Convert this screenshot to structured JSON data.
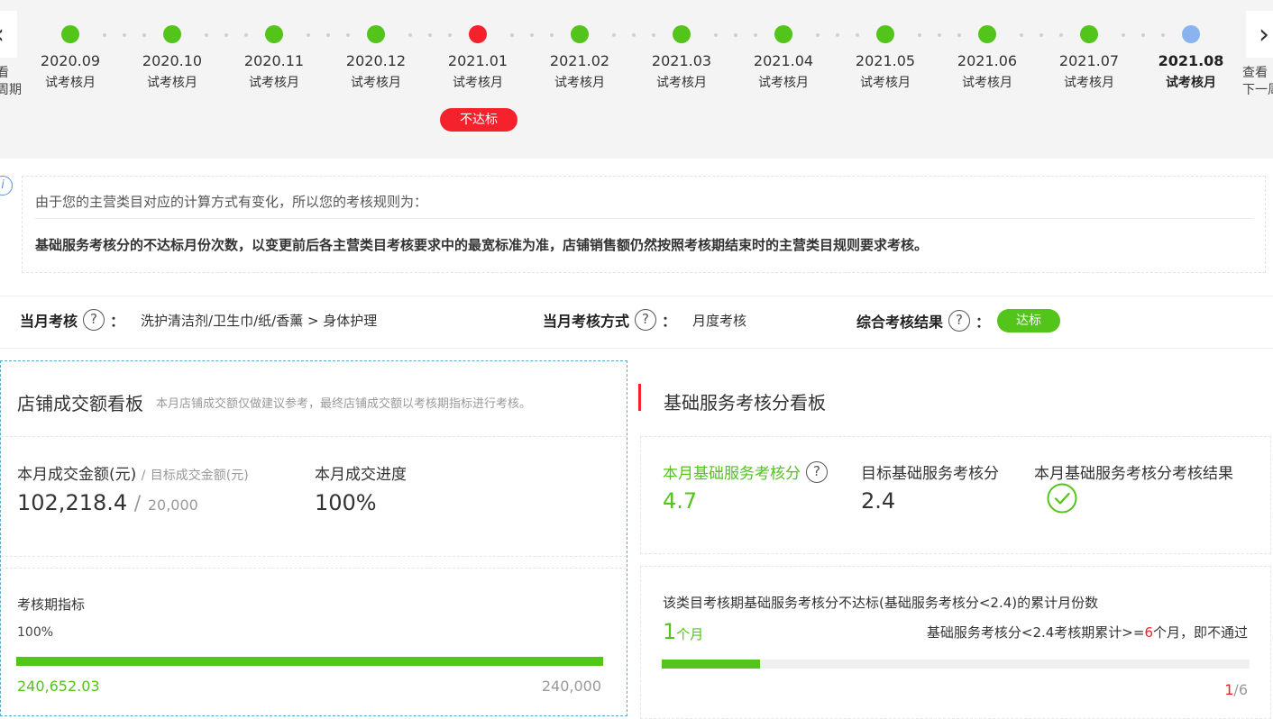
{
  "timeline": {
    "prev_label": [
      "看",
      "周期"
    ],
    "next_label": [
      "查看",
      "下一周"
    ],
    "months": [
      {
        "date": "2020.09",
        "label": "试考核月",
        "status": "pass"
      },
      {
        "date": "2020.10",
        "label": "试考核月",
        "status": "pass"
      },
      {
        "date": "2020.11",
        "label": "试考核月",
        "status": "pass"
      },
      {
        "date": "2020.12",
        "label": "试考核月",
        "status": "pass"
      },
      {
        "date": "2021.01",
        "label": "试考核月",
        "status": "fail",
        "badge": "不达标"
      },
      {
        "date": "2021.02",
        "label": "试考核月",
        "status": "pass"
      },
      {
        "date": "2021.03",
        "label": "试考核月",
        "status": "pass"
      },
      {
        "date": "2021.04",
        "label": "试考核月",
        "status": "pass"
      },
      {
        "date": "2021.05",
        "label": "试考核月",
        "status": "pass"
      },
      {
        "date": "2021.06",
        "label": "试考核月",
        "status": "pass"
      },
      {
        "date": "2021.07",
        "label": "试考核月",
        "status": "pass"
      },
      {
        "date": "2021.08",
        "label": "试考核月",
        "status": "current"
      }
    ]
  },
  "colors": {
    "pass": "#52c41a",
    "fail": "#f5222d",
    "current": "#8ab4f0"
  },
  "notice": {
    "line1": "由于您的主营类目对应的计算方式有变化，所以您的考核规则为：",
    "line2": "基础服务考核分的不达标月份次数，以变更前后各主营类目考核要求中的最宽标准为准，店铺销售额仍然按照考核期结束时的主营类目规则要求考核。"
  },
  "summary": {
    "current_label": "当月考核",
    "current_value": "洗护清洁剂/卫生巾/纸/香薰 > 身体护理",
    "method_label": "当月考核方式",
    "method_value": "月度考核",
    "result_label": "综合考核结果",
    "result_value": "达标",
    "help_glyph": "?",
    "colon": "："
  },
  "sales": {
    "title": "店铺成交额看板",
    "desc": "本月店铺成交额仅做建议参考，最终店铺成交额以考核期指标进行考核。",
    "amount_label": "本月成交金额(元)",
    "amount_sep": "/",
    "target_label": "目标成交金额(元)",
    "amount_value": "102,218.4",
    "target_value": "20,000",
    "progress_label": "本月成交进度",
    "progress_value": "100%",
    "period_label": "考核期指标",
    "period_pct": "100%",
    "period_fill": 1.0,
    "period_current": "240,652.03",
    "period_target": "240,000"
  },
  "service": {
    "title": "基础服务考核分看板",
    "score_label": "本月基础服务考核分",
    "score_value": "4.7",
    "target_label": "目标基础服务考核分",
    "target_value": "2.4",
    "result_label": "本月基础服务考核分考核结果",
    "cum_title": "该类目考核期基础服务考核分不达标(基础服务考核分<2.4)的累计月份数",
    "cum_value": "1",
    "cum_unit": "个月",
    "cum_rule_pre": "基础服务考核分<2.4考核期累计>=",
    "cum_rule_num": "6",
    "cum_rule_post": "个月，即不通过",
    "cum_count": "1",
    "cum_total": "/6",
    "cum_fill": 0.1667
  }
}
